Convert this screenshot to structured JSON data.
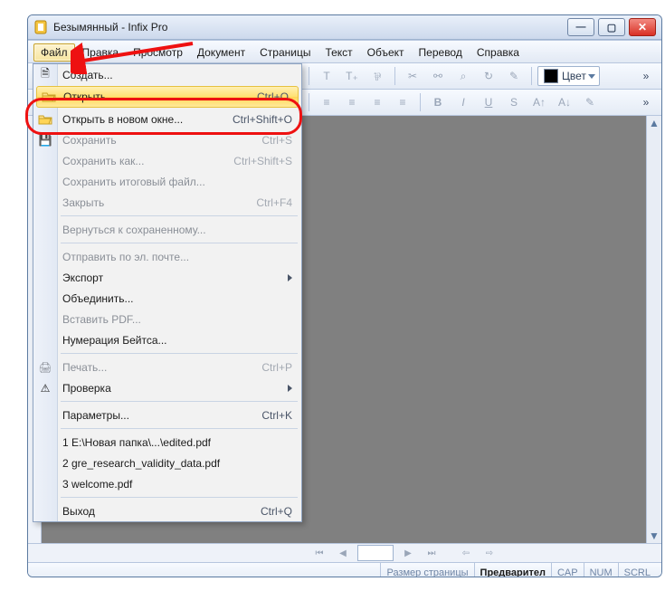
{
  "title": "Безымянный - Infix Pro",
  "menubar": [
    "Файл",
    "Правка",
    "Просмотр",
    "Документ",
    "Страницы",
    "Текст",
    "Объект",
    "Перевод",
    "Справка"
  ],
  "toolbar_top": {
    "font": "",
    "color_label": "Цвет"
  },
  "navbar": {
    "page_field": ""
  },
  "status": {
    "page_size": "Размер страницы",
    "preview": "Предварител",
    "cap": "CAP",
    "num": "NUM",
    "scrl": "SCRL"
  },
  "menu": {
    "create": {
      "label": "Создать...",
      "hotkey": ""
    },
    "open": {
      "label": "Открыть...",
      "hotkey": "Ctrl+O"
    },
    "open_new": {
      "label": "Открыть в новом окне...",
      "hotkey": "Ctrl+Shift+O"
    },
    "save": {
      "label": "Сохранить",
      "hotkey": "Ctrl+S"
    },
    "save_as": {
      "label": "Сохранить как...",
      "hotkey": "Ctrl+Shift+S"
    },
    "save_final": {
      "label": "Сохранить итоговый файл...",
      "hotkey": ""
    },
    "close": {
      "label": "Закрыть",
      "hotkey": "Ctrl+F4"
    },
    "revert": {
      "label": "Вернуться к сохраненному...",
      "hotkey": ""
    },
    "email": {
      "label": "Отправить по эл. почте...",
      "hotkey": ""
    },
    "export": {
      "label": "Экспорт",
      "hotkey": ""
    },
    "join": {
      "label": "Объединить...",
      "hotkey": ""
    },
    "insert_pdf": {
      "label": "Вставить PDF...",
      "hotkey": ""
    },
    "bates": {
      "label": "Нумерация Бейтса...",
      "hotkey": ""
    },
    "print": {
      "label": "Печать...",
      "hotkey": "Ctrl+P"
    },
    "check": {
      "label": "Проверка",
      "hotkey": ""
    },
    "prefs": {
      "label": "Параметры...",
      "hotkey": "Ctrl+K"
    },
    "recent1": {
      "label": "1 E:\\Новая папка\\...\\edited.pdf",
      "hotkey": ""
    },
    "recent2": {
      "label": "2 gre_research_validity_data.pdf",
      "hotkey": ""
    },
    "recent3": {
      "label": "3 welcome.pdf",
      "hotkey": ""
    },
    "exit": {
      "label": "Выход",
      "hotkey": "Ctrl+Q"
    }
  }
}
